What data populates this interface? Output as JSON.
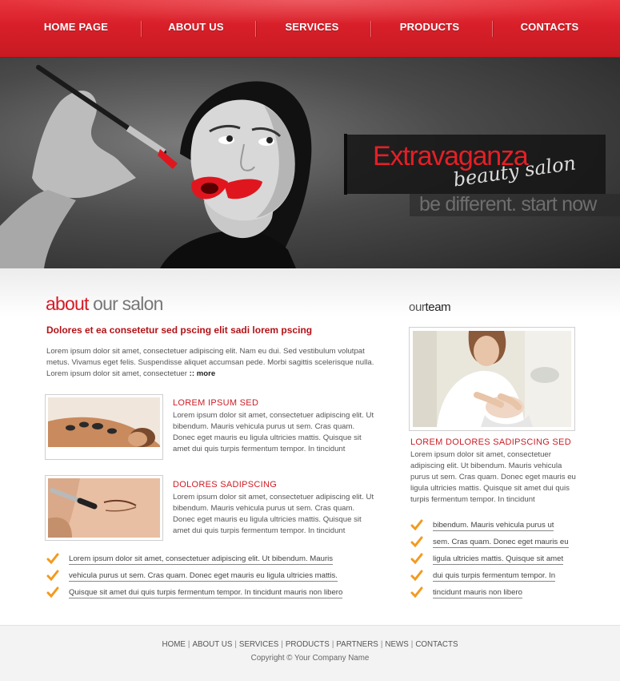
{
  "nav": {
    "items": [
      {
        "label": "HOME PAGE"
      },
      {
        "label": "ABOUT US"
      },
      {
        "label": "SERVICES"
      },
      {
        "label": "PRODUCTS"
      },
      {
        "label": "CONTACTS"
      }
    ]
  },
  "hero": {
    "brand_title": "Extravaganza",
    "brand_subtitle": "beauty salon",
    "tagline": "be different. start now"
  },
  "about": {
    "title_accent": "about",
    "title_rest": "our salon",
    "lead": "Dolores et ea consetetur sed pscing elit sadi lorem pscing",
    "intro": "Lorem ipsum dolor sit amet, consectetuer adipiscing elit. Nam eu dui. Sed vestibulum volutpat metus. Vivamus eget felis. Suspendisse aliquet accumsan pede. Morbi sagittis scelerisque nulla. Lorem ipsum dolor sit amet, consectetuer",
    "more_label": ":: more",
    "features": [
      {
        "title": "LOREM IPSUM SED",
        "text": "Lorem ipsum dolor sit amet, consectetuer adipiscing elit. Ut bibendum. Mauris vehicula purus ut sem. Cras quam. Donec eget mauris eu ligula ultricies mattis. Quisque sit amet dui quis turpis fermentum tempor. In tincidunt"
      },
      {
        "title": "DOLORES SADIPSCING",
        "text": "Lorem ipsum dolor sit amet, consectetuer adipiscing elit. Ut bibendum. Mauris vehicula purus ut sem. Cras quam. Donec eget mauris eu ligula ultricies mattis. Quisque sit amet dui quis turpis fermentum tempor. In tincidunt"
      }
    ],
    "links": [
      {
        "label": "Lorem ipsum dolor sit amet, consectetuer adipiscing elit. Ut bibendum. Mauris"
      },
      {
        "label": "vehicula purus ut sem. Cras quam. Donec eget mauris eu ligula ultricies mattis."
      },
      {
        "label": "Quisque sit amet dui quis turpis fermentum tempor. In tincidunt mauris non libero"
      }
    ]
  },
  "team": {
    "title_light": "our",
    "title_dark": "team",
    "heading": "LOREM DOLORES SADIPSCING SED",
    "text": "Lorem ipsum dolor sit amet, consectetuer adipiscing elit. Ut bibendum. Mauris vehicula purus ut sem. Cras quam. Donec eget mauris eu ligula ultricies mattis. Quisque sit amet dui quis turpis fermentum tempor. In tincidunt",
    "links": [
      {
        "label": "bibendum. Mauris vehicula purus ut"
      },
      {
        "label": "sem. Cras quam. Donec eget mauris eu"
      },
      {
        "label": "ligula ultricies mattis. Quisque sit amet"
      },
      {
        "label": "dui quis turpis fermentum tempor. In"
      },
      {
        "label": "tincidunt mauris non libero"
      }
    ]
  },
  "footer": {
    "links": [
      {
        "label": "HOME"
      },
      {
        "label": "ABOUT US"
      },
      {
        "label": "SERVICES"
      },
      {
        "label": "PRODUCTS"
      },
      {
        "label": "PARTNERS"
      },
      {
        "label": "NEWS"
      },
      {
        "label": "CONTACTS"
      }
    ],
    "separator": "|",
    "copyright": "Copyright © Your Company Name"
  },
  "colors": {
    "accent_red": "#d71b24",
    "nav_red": "#d81f29",
    "check_orange": "#f39a1e"
  },
  "icons": {
    "check": "checkmark-icon"
  }
}
